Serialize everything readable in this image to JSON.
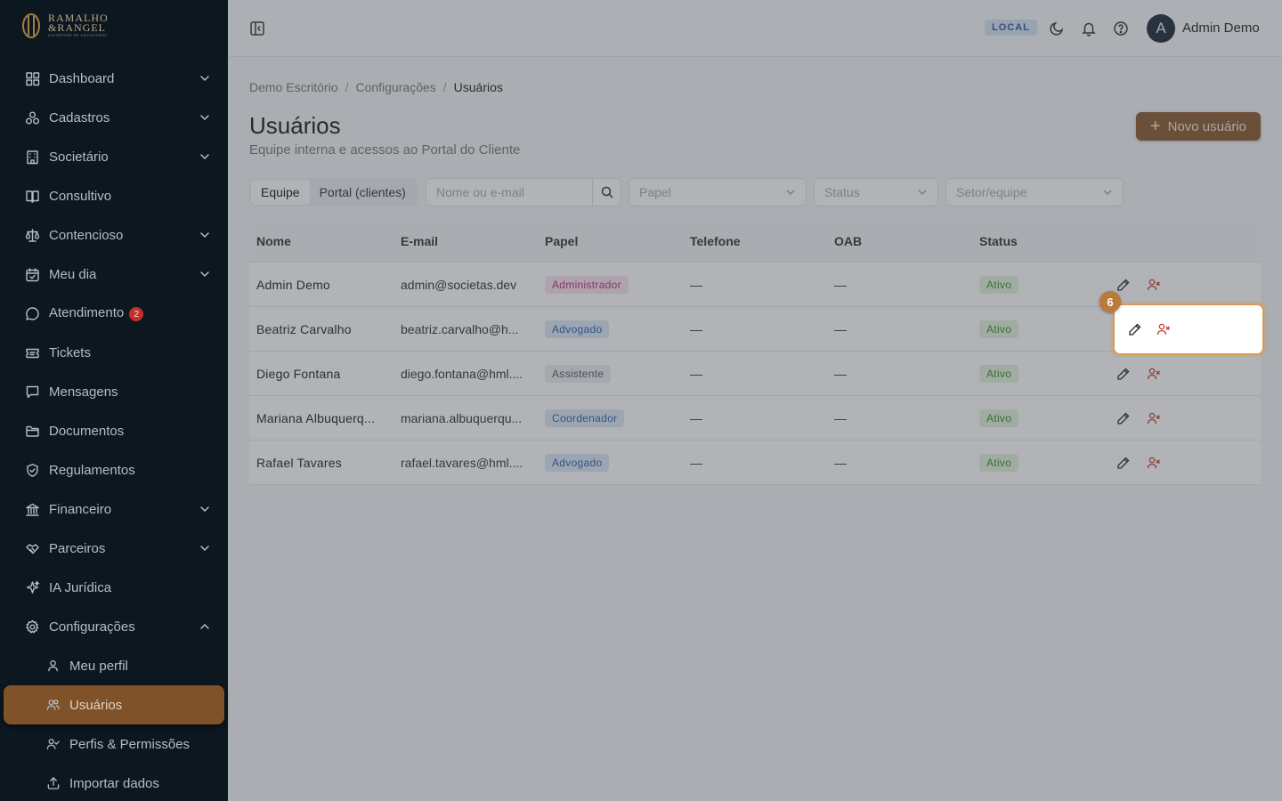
{
  "brand": {
    "line1": "RAMALHO",
    "line2": "&RANGEL",
    "tagline": "SOCIEDADE DE ADVOGADOS"
  },
  "sidebar": {
    "items": [
      {
        "label": "Dashboard",
        "icon": "dashboard-icon",
        "chevron": "down"
      },
      {
        "label": "Cadastros",
        "icon": "cadastros-icon",
        "chevron": "down"
      },
      {
        "label": "Societário",
        "icon": "building-icon",
        "chevron": "down"
      },
      {
        "label": "Consultivo",
        "icon": "book-icon",
        "chevron": ""
      },
      {
        "label": "Contencioso",
        "icon": "scale-icon",
        "chevron": "down"
      },
      {
        "label": "Meu dia",
        "icon": "calendar-icon",
        "chevron": "down"
      },
      {
        "label": "Atendimento",
        "icon": "chat-icon",
        "chevron": "",
        "badge": "2"
      },
      {
        "label": "Tickets",
        "icon": "ticket-icon",
        "chevron": ""
      },
      {
        "label": "Mensagens",
        "icon": "message-icon",
        "chevron": ""
      },
      {
        "label": "Documentos",
        "icon": "folder-icon",
        "chevron": ""
      },
      {
        "label": "Regulamentos",
        "icon": "shield-icon",
        "chevron": ""
      },
      {
        "label": "Financeiro",
        "icon": "bank-icon",
        "chevron": "down"
      },
      {
        "label": "Parceiros",
        "icon": "handshake-icon",
        "chevron": "down"
      },
      {
        "label": "IA Jurídica",
        "icon": "sparkles-icon",
        "chevron": ""
      },
      {
        "label": "Configurações",
        "icon": "gear-icon",
        "chevron": "up"
      }
    ],
    "subitems": [
      {
        "label": "Meu perfil",
        "icon": "user-icon"
      },
      {
        "label": "Usuários",
        "icon": "users-icon",
        "active": true
      },
      {
        "label": "Perfis & Permissões",
        "icon": "user-check-icon"
      },
      {
        "label": "Importar dados",
        "icon": "upload-icon"
      }
    ]
  },
  "header": {
    "env_badge": "LOCAL",
    "avatar_initial": "A",
    "user_name": "Admin Demo"
  },
  "breadcrumb": [
    "Demo Escritório",
    "Configurações",
    "Usuários"
  ],
  "page": {
    "title": "Usuários",
    "subtitle": "Equipe interna e acessos ao Portal do Cliente",
    "new_button": "Novo usuário"
  },
  "filters": {
    "tabs": [
      "Equipe",
      "Portal (clientes)"
    ],
    "search_placeholder": "Nome ou e-mail",
    "papel_placeholder": "Papel",
    "status_placeholder": "Status",
    "setor_placeholder": "Setor/equipe"
  },
  "table": {
    "columns": [
      "Nome",
      "E-mail",
      "Papel",
      "Telefone",
      "OAB",
      "Status"
    ],
    "rows": [
      {
        "nome": "Admin Demo",
        "email": "admin@societas.dev",
        "papel": "Administrador",
        "papel_style": "admin",
        "telefone": "—",
        "oab": "—",
        "status": "Ativo"
      },
      {
        "nome": "Beatriz Carvalho",
        "email": "beatriz.carvalho@h...",
        "papel": "Advogado",
        "papel_style": "adv",
        "telefone": "—",
        "oab": "—",
        "status": "Ativo"
      },
      {
        "nome": "Diego Fontana",
        "email": "diego.fontana@hml....",
        "papel": "Assistente",
        "papel_style": "asst",
        "telefone": "—",
        "oab": "—",
        "status": "Ativo"
      },
      {
        "nome": "Mariana Albuquerq...",
        "email": "mariana.albuquerqu...",
        "papel": "Coordenador",
        "papel_style": "coord",
        "telefone": "—",
        "oab": "—",
        "status": "Ativo"
      },
      {
        "nome": "Rafael Tavares",
        "email": "rafael.tavares@hml....",
        "papel": "Advogado",
        "papel_style": "adv",
        "telefone": "—",
        "oab": "—",
        "status": "Ativo"
      }
    ]
  },
  "tutorial": {
    "step": "6"
  },
  "colors": {
    "sidebar_bg": "#0f1923",
    "accent": "#8a5a2e",
    "highlight_border": "#d79a5a",
    "danger": "#c0392b"
  }
}
